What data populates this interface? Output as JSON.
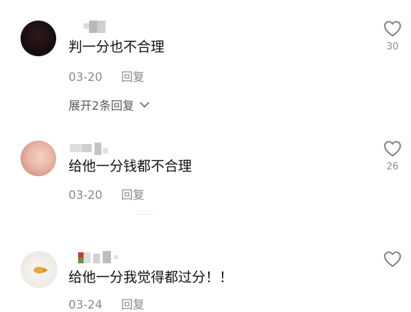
{
  "comments": [
    {
      "text": "判一分也不合理",
      "date": "03-20",
      "reply_label": "回复",
      "expand_label": "展开2条回复",
      "likes": "30"
    },
    {
      "text": "给他一分钱都不合理",
      "date": "03-20",
      "reply_label": "回复",
      "likes": "26"
    },
    {
      "text": "给他一分我觉得都过分！！",
      "date": "03-24",
      "reply_label": "回复",
      "likes": ""
    }
  ],
  "icons": {
    "like": "heart-outline-icon",
    "expand": "chevron-down-icon"
  },
  "colors": {
    "text": "#111111",
    "meta": "#8a8a8a",
    "icon": "#7a7a7a"
  }
}
